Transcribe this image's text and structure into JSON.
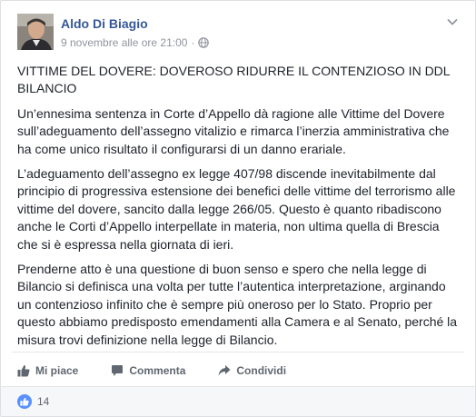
{
  "post": {
    "author": "Aldo Di Biagio",
    "timestamp": "9 novembre alle ore 21:00",
    "separator": "·",
    "privacy_icon": "globe-icon",
    "menu_icon": "chevron-down-icon",
    "paragraphs": [
      "VITTIME DEL DOVERE: DOVEROSO RIDURRE IL CONTENZIOSO IN DDL BILANCIO",
      "Un’ennesima sentenza in Corte d’Appello dà ragione alle Vittime del Dovere sull’adeguamento dell’assegno vitalizio e rimarca l’inerzia amministrativa che ha come unico risultato il configurarsi di un danno erariale.",
      "L’adeguamento dell’assegno ex legge 407/98 discende inevitabilmente dal principio di progressiva estensione dei benefici delle vittime del terrorismo alle vittime del dovere, sancito dalla legge 266/05. Questo è quanto ribadiscono anche le Corti d’Appello interpellate in materia, non ultima quella di Brescia che si è espressa nella giornata di ieri.",
      "Prenderne atto è una questione di buon senso e spero che nella legge di Bilancio si definisca una volta per tutte l’autentica interpretazione, arginando un contenzioso infinito che è sempre più oneroso per lo Stato. Proprio per questo abbiamo predisposto emendamenti alla Camera e al Senato, perché la misura trovi definizione nella legge di Bilancio."
    ]
  },
  "actions": {
    "like_label": "Mi piace",
    "comment_label": "Commenta",
    "share_label": "Condividi"
  },
  "reactions": {
    "count": "14"
  },
  "colors": {
    "link": "#365899",
    "text": "#1d2129",
    "muted": "#90949c",
    "like_blue": "#5890ff"
  }
}
